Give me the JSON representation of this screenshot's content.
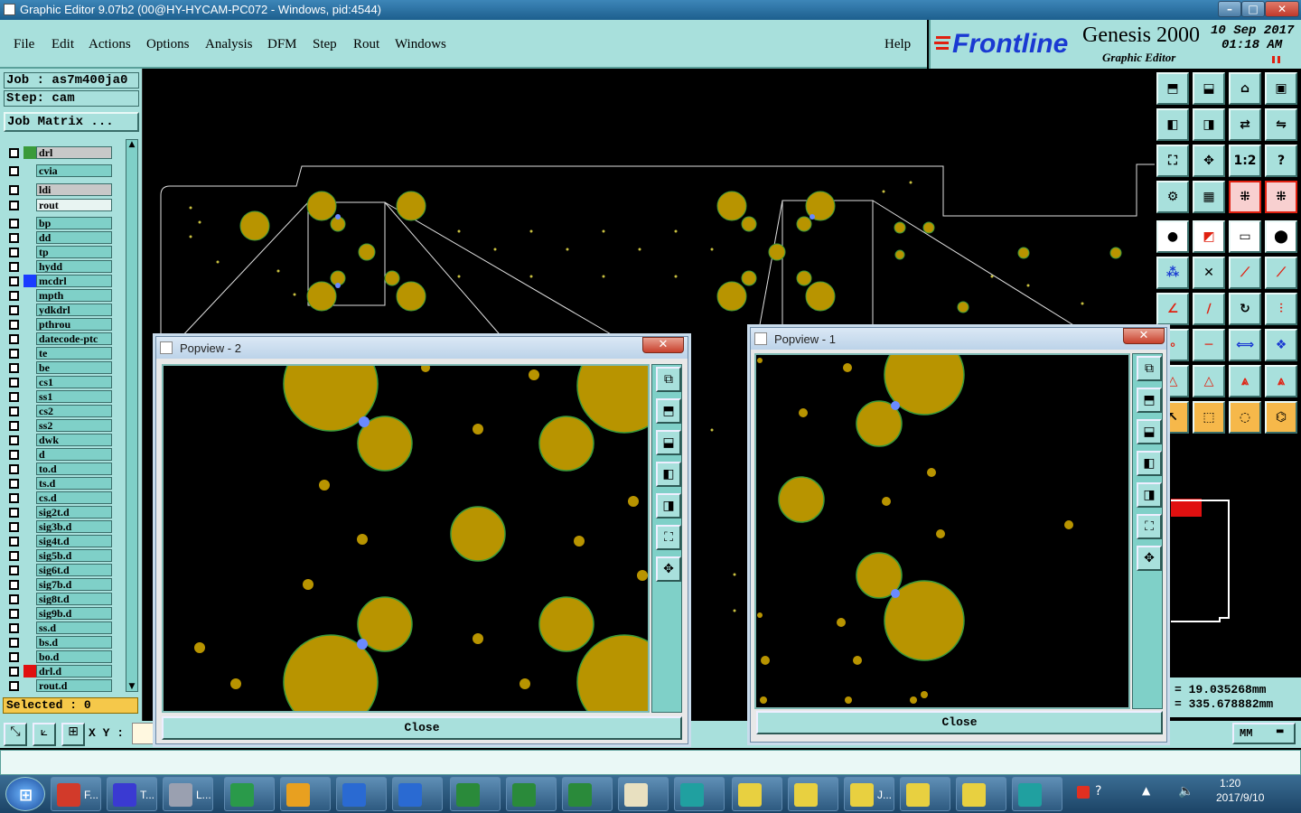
{
  "window": {
    "title": "Graphic Editor 9.07b2 (00@HY-HYCAM-PC072 - Windows, pid:4544)",
    "min": "–",
    "max": "□",
    "close": "✕"
  },
  "menu": {
    "items": [
      "File",
      "Edit",
      "Actions",
      "Options",
      "Analysis",
      "DFM",
      "Step",
      "Rout",
      "Windows"
    ],
    "help": "Help"
  },
  "brand": {
    "frontline": "Frontline",
    "product": "Genesis 2000",
    "subtitle": "Graphic Editor",
    "date": "10 Sep 2017",
    "time": "01:18 AM"
  },
  "job": {
    "job_label": "Job : as7m400ja0",
    "step_label": "Step: cam",
    "matrix_button": "Job Matrix ..."
  },
  "layers": [
    {
      "name": "drl",
      "swatch": "#3a9a3a",
      "style": "hl"
    },
    {
      "name": "cvia",
      "swatch": "",
      "style": ""
    },
    {
      "name": "ldi",
      "swatch": "",
      "style": "hl"
    },
    {
      "name": "rout",
      "swatch": "",
      "style": "wh"
    },
    {
      "name": "bp",
      "swatch": "",
      "style": ""
    },
    {
      "name": "dd",
      "swatch": "",
      "style": ""
    },
    {
      "name": "tp",
      "swatch": "",
      "style": ""
    },
    {
      "name": "hydd",
      "swatch": "",
      "style": ""
    },
    {
      "name": "mcdrl",
      "swatch": "#1a3cff",
      "style": ""
    },
    {
      "name": "mpth",
      "swatch": "",
      "style": ""
    },
    {
      "name": "ydkdrl",
      "swatch": "",
      "style": ""
    },
    {
      "name": "pthrou",
      "swatch": "",
      "style": ""
    },
    {
      "name": "datecode-ptc",
      "swatch": "",
      "style": ""
    },
    {
      "name": "te",
      "swatch": "",
      "style": ""
    },
    {
      "name": "be",
      "swatch": "",
      "style": ""
    },
    {
      "name": "cs1",
      "swatch": "",
      "style": ""
    },
    {
      "name": "ss1",
      "swatch": "",
      "style": ""
    },
    {
      "name": "cs2",
      "swatch": "",
      "style": ""
    },
    {
      "name": "ss2",
      "swatch": "",
      "style": ""
    },
    {
      "name": "dwk",
      "swatch": "",
      "style": ""
    },
    {
      "name": "d",
      "swatch": "",
      "style": ""
    },
    {
      "name": "to.d",
      "swatch": "",
      "style": ""
    },
    {
      "name": "ts.d",
      "swatch": "",
      "style": ""
    },
    {
      "name": "cs.d",
      "swatch": "",
      "style": ""
    },
    {
      "name": "sig2t.d",
      "swatch": "",
      "style": ""
    },
    {
      "name": "sig3b.d",
      "swatch": "",
      "style": ""
    },
    {
      "name": "sig4t.d",
      "swatch": "",
      "style": ""
    },
    {
      "name": "sig5b.d",
      "swatch": "",
      "style": ""
    },
    {
      "name": "sig6t.d",
      "swatch": "",
      "style": ""
    },
    {
      "name": "sig7b.d",
      "swatch": "",
      "style": ""
    },
    {
      "name": "sig8t.d",
      "swatch": "",
      "style": ""
    },
    {
      "name": "sig9b.d",
      "swatch": "",
      "style": ""
    },
    {
      "name": "ss.d",
      "swatch": "",
      "style": ""
    },
    {
      "name": "bs.d",
      "swatch": "",
      "style": ""
    },
    {
      "name": "bo.d",
      "swatch": "",
      "style": ""
    },
    {
      "name": "drl.d",
      "swatch": "#e01010",
      "style": ""
    },
    {
      "name": "rout.d",
      "swatch": "",
      "style": ""
    }
  ],
  "selected": "Selected : 0",
  "coords": {
    "xy_label": "X Y :",
    "x": "= 19.035268mm",
    "y": "= 335.678882mm",
    "units": "MM"
  },
  "popup2": {
    "title": "Popview - 2",
    "close": "Close"
  },
  "popup1": {
    "title": "Popview - 1",
    "close": "Close"
  },
  "tools": [
    "1:2",
    "?"
  ],
  "clock": {
    "time": "1:20",
    "date": "2017/9/10"
  },
  "taskbar_items": [
    {
      "label": "F...",
      "color": "#d23a2a"
    },
    {
      "label": "T...",
      "color": "#3a3ad2"
    },
    {
      "label": "L...",
      "color": "#9aa0b0"
    },
    {
      "label": "",
      "color": "#2a9a4a"
    },
    {
      "label": "",
      "color": "#e8a020"
    },
    {
      "label": "",
      "color": "#2a6ad2"
    },
    {
      "label": "",
      "color": "#2a6ad2"
    },
    {
      "label": "",
      "color": "#2a8a3a"
    },
    {
      "label": "",
      "color": "#2a8a3a"
    },
    {
      "label": "",
      "color": "#2a8a3a"
    },
    {
      "label": "",
      "color": "#e8e0c0"
    },
    {
      "label": "",
      "color": "#20a0a0"
    },
    {
      "label": "",
      "color": "#e8d040"
    },
    {
      "label": "",
      "color": "#e8d040"
    },
    {
      "label": "J...",
      "color": "#e8d040"
    },
    {
      "label": "",
      "color": "#e8d040"
    },
    {
      "label": "",
      "color": "#e8d040"
    },
    {
      "label": "",
      "color": "#20a0a0"
    }
  ]
}
